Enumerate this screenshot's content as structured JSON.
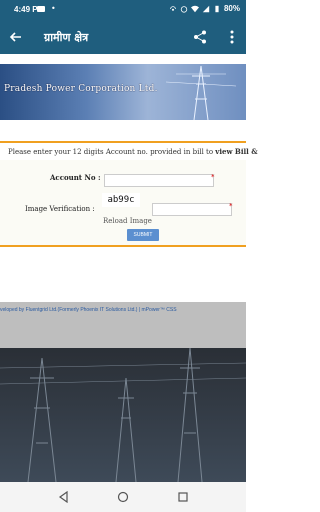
{
  "status_bar": {
    "time": "4:49 PM",
    "battery": "80%"
  },
  "app_bar": {
    "title": "ग्रामीण क्षेत्र"
  },
  "banner": {
    "text": "Pradesh Power Corporation Ltd."
  },
  "form": {
    "notice_prefix": "Please enter your 12 digits Account no. provided in bill to ",
    "notice_bold": "view Bill &",
    "account_label": "Account No :",
    "account_value": "",
    "image_label": "Image Verification :",
    "captcha_text": "ab99c",
    "captcha_value": "",
    "reload_label": "Reload Image",
    "submit_label": "SUBMIT"
  },
  "footer": {
    "credit_text": "veloped by Fluentgrid Ltd.(Formerly Phoenix IT Solutions Ltd.) | mPower™ CSS"
  },
  "colors": {
    "app_bar": "#1f5e7e",
    "accent": "#f0a020",
    "submit": "#5b8fd0"
  }
}
